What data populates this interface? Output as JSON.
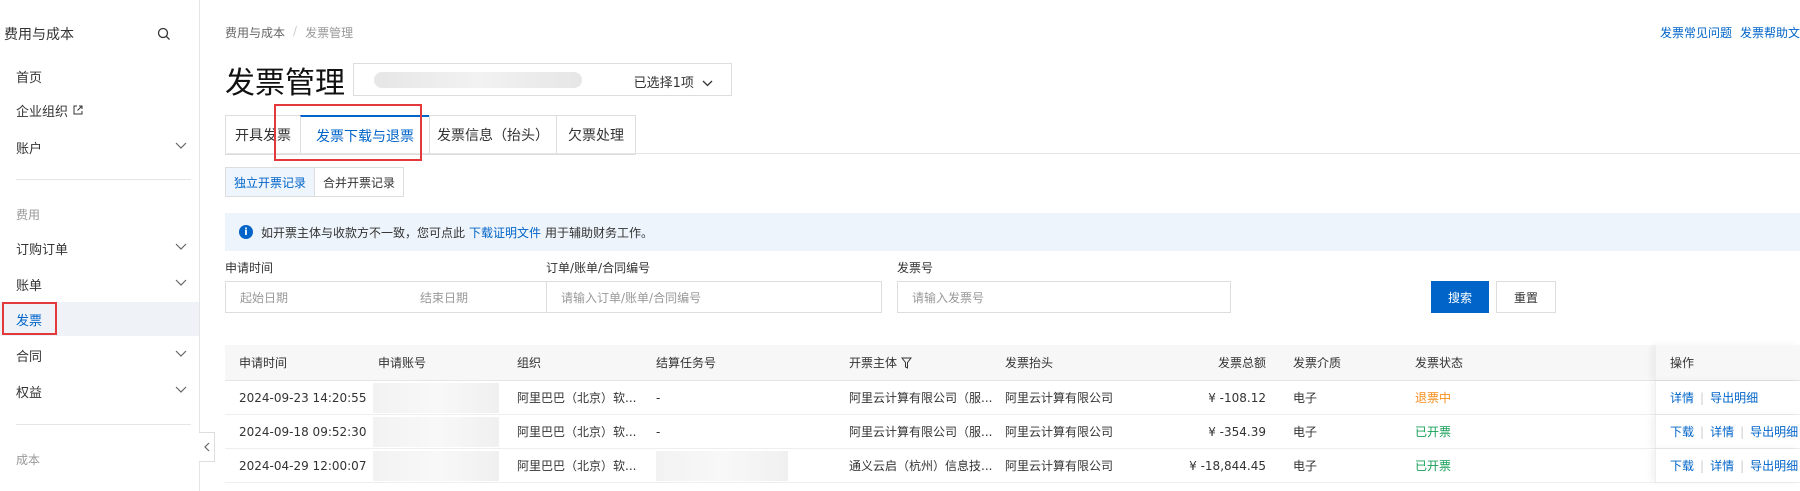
{
  "sidebar": {
    "title": "费用与成本",
    "items": {
      "home": "首页",
      "org": "企业组织",
      "account": "账户",
      "section_fee": "费用",
      "orders": "订购订单",
      "bills": "账单",
      "invoice": "发票",
      "contract": "合同",
      "benefits": "权益",
      "section_cost": "成本"
    }
  },
  "header": {
    "breadcrumb": [
      "费用与成本",
      "/",
      "发票管理"
    ],
    "title": "发票管理",
    "account_select_text": "已选择1项",
    "help_links": [
      "发票常见问题",
      "发票帮助文"
    ]
  },
  "tabs": [
    "开具发票",
    "发票下载与退票",
    "发票信息（抬头）",
    "欠票处理"
  ],
  "subtabs": [
    "独立开票记录",
    "合并开票记录"
  ],
  "notice": {
    "before": "如开票主体与收款方不一致，您可点此",
    "link": "下载证明文件",
    "after": "用于辅助财务工作。"
  },
  "filters": {
    "apply_time_label": "申请时间",
    "start_placeholder": "起始日期",
    "end_placeholder": "结束日期",
    "order_label": "订单/账单/合同编号",
    "order_placeholder": "请输入订单/账单/合同编号",
    "invoice_no_label": "发票号",
    "invoice_no_placeholder": "请输入发票号",
    "search_button": "搜索",
    "reset_button": "重置"
  },
  "table": {
    "headers": [
      "申请时间",
      "申请账号",
      "组织",
      "结算任务号",
      "开票主体",
      "发票抬头",
      "发票总额",
      "发票介质",
      "发票状态",
      "操作"
    ],
    "rows": [
      {
        "time": "2024-09-23 14:20:55",
        "org": "阿里巴巴（北京）软...",
        "task": "-",
        "entity": "阿里云计算有限公司（服...",
        "header": "阿里云计算有限公司",
        "amount": "¥ -108.12",
        "medium": "电子",
        "status": "退票中",
        "ops": [
          "详情",
          "导出明细"
        ]
      },
      {
        "time": "2024-09-18 09:52:30",
        "org": "阿里巴巴（北京）软...",
        "task": "-",
        "entity": "阿里云计算有限公司（服...",
        "header": "阿里云计算有限公司",
        "amount": "¥ -354.39",
        "medium": "电子",
        "status": "已开票",
        "ops": [
          "下载",
          "详情",
          "导出明细"
        ]
      },
      {
        "time": "2024-04-29 12:00:07",
        "org": "阿里巴巴（北京）软...",
        "task": "",
        "entity": "通义云启（杭州）信息技...",
        "header": "阿里云计算有限公司",
        "amount": "¥ -18,844.45",
        "medium": "电子",
        "status": "已开票",
        "ops": [
          "下载",
          "详情",
          "导出明细"
        ]
      }
    ]
  },
  "colors": {
    "accent": "#0064c8",
    "highlight": "#e4393c",
    "status_pending": "#f98e1a",
    "status_done": "#18a058"
  }
}
